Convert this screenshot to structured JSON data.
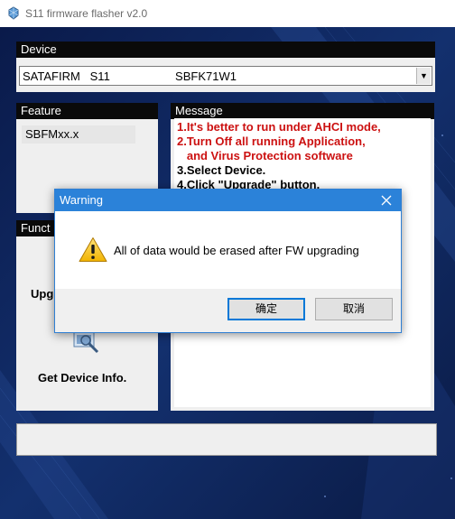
{
  "window": {
    "title": "S11 firmware flasher v2.0",
    "icon": "app-icon"
  },
  "device": {
    "header": "Device",
    "selected": "SATAFIRM   S11                    SBFK71W1"
  },
  "feature": {
    "header": "Feature",
    "items": [
      "SBFMxx.x"
    ]
  },
  "message": {
    "header": "Message",
    "lines": [
      "1.It's better to run under AHCI mode,",
      "2.Turn Off all running Application,",
      "   and Virus Protection software",
      "3.Select Device.",
      "4.Click \"Upgrade\" button."
    ]
  },
  "function": {
    "header": "Funct",
    "upgrade_label": "Upg",
    "get_info_label": "Get Device Info."
  },
  "dialog": {
    "title": "Warning",
    "message": "All of data would be erased after FW upgrading",
    "ok_label": "确定",
    "cancel_label": "取消"
  },
  "colors": {
    "panel_header": "#0a0a0a",
    "message_red": "#cc1111",
    "dialog_titlebar": "#2b82d9",
    "background": "#0c1e52"
  }
}
